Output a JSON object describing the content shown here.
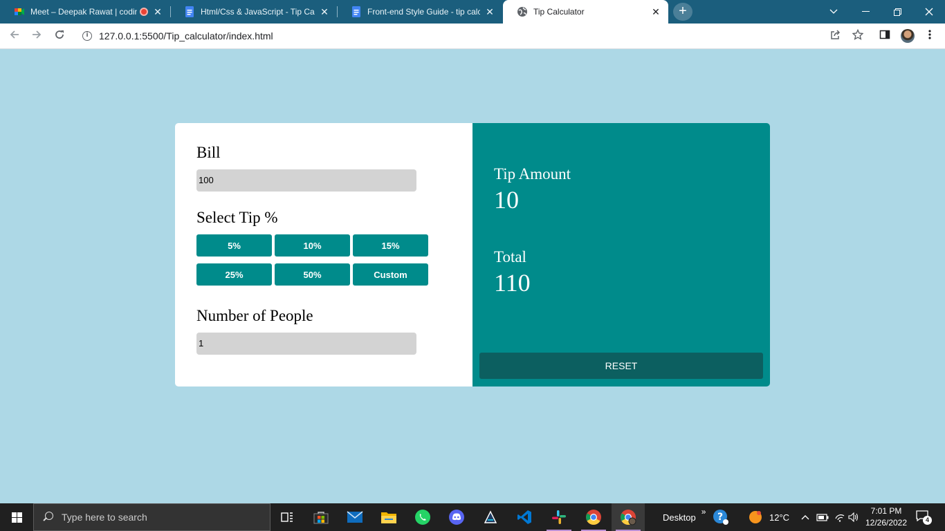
{
  "browser": {
    "tabs": [
      {
        "title": "Meet – Deepak Rawat | codin",
        "favicon": "google-meet-icon",
        "recording": true
      },
      {
        "title": "Html/Css & JavaScript - Tip Calcu",
        "favicon": "google-docs-icon"
      },
      {
        "title": "Front-end Style Guide - tip calcul",
        "favicon": "google-docs-icon"
      },
      {
        "title": "Tip Calculator",
        "favicon": "globe-icon",
        "active": true
      }
    ],
    "new_tab": "+",
    "url": "127.0.0.1:5500/Tip_calculator/index.html"
  },
  "app": {
    "bill": {
      "label": "Bill",
      "value": "100"
    },
    "tip": {
      "label": "Select Tip %",
      "options": [
        "5%",
        "10%",
        "15%",
        "25%",
        "50%",
        "Custom"
      ]
    },
    "people": {
      "label": "Number of People",
      "value": "1"
    },
    "results": {
      "tip_label": "Tip Amount",
      "tip_value": "10",
      "total_label": "Total",
      "total_value": "110",
      "reset_label": "RESET"
    },
    "colors": {
      "page_bg": "#add8e6",
      "accent": "#008b8b",
      "reset_bg": "#0c5f60",
      "input_bg": "#d3d3d3"
    }
  },
  "taskbar": {
    "search_placeholder": "Type here to search",
    "desktop_label": "Desktop",
    "desktop_chevron": "»",
    "temperature": "12°C",
    "time": "7:01 PM",
    "date": "12/26/2022",
    "notification_count": "4"
  }
}
